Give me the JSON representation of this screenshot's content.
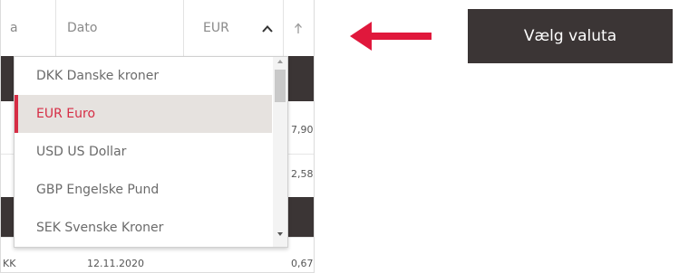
{
  "table": {
    "header": {
      "col_a_fragment": "a",
      "date_label": "Dato",
      "currency_value": "EUR",
      "caret_icon": "chevron-up-icon",
      "sort_icon": "arrow-up-icon"
    },
    "rows": [
      {
        "left_fragment": "",
        "date": "",
        "amount": "7,90"
      },
      {
        "left_fragment": "",
        "date": "",
        "amount": "2,58"
      },
      {
        "left_fragment": "KK",
        "date": "12.11.2020",
        "amount": "0,67"
      }
    ]
  },
  "currency_dropdown": {
    "options": [
      {
        "label": "DKK Danske kroner",
        "selected": false
      },
      {
        "label": "EUR Euro",
        "selected": true
      },
      {
        "label": "USD US Dollar",
        "selected": false
      },
      {
        "label": "GBP Engelske Pund",
        "selected": false
      },
      {
        "label": "SEK Svenske Kroner",
        "selected": false
      }
    ]
  },
  "annotation": {
    "arrow_icon": "arrow-left-icon",
    "arrow_color": "#e0183c",
    "callout_text": "Vælg valuta"
  },
  "colors": {
    "accent": "#d62d45",
    "dark_band": "#3b3535",
    "selected_bg": "#e6e2df"
  }
}
